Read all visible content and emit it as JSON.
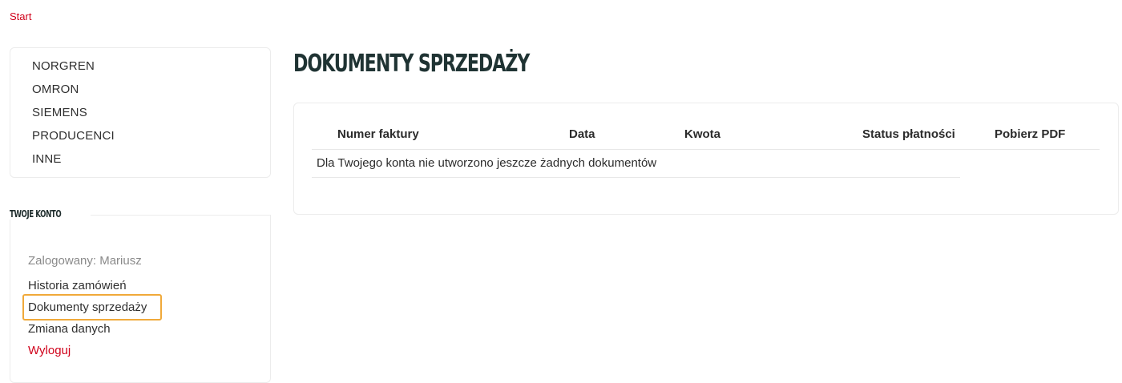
{
  "breadcrumb": {
    "start_label": "Start"
  },
  "categories": {
    "items": [
      "NORGREN",
      "OMRON",
      "SIEMENS",
      "PRODUCENCI",
      "INNE"
    ]
  },
  "account": {
    "heading": "TWOJE KONTO",
    "logged_in": "Zalogowany: Mariusz",
    "history_label": "Historia zamówień",
    "documents_label": "Dokumenty sprzedaży",
    "change_data_label": "Zmiana danych",
    "logout_label": "Wyloguj"
  },
  "main": {
    "title": "DOKUMENTY SPRZEDAŻY",
    "table": {
      "columns": [
        "Numer faktury",
        "Data",
        "Kwota",
        "Status płatności",
        "Pobierz PDF"
      ],
      "empty_message": "Dla Twojego konta nie utworzono jeszcze żadnych dokumentów"
    }
  },
  "colors": {
    "accent_red": "#d0021b",
    "highlight_orange": "#f0a93a",
    "title_dark": "#1f3333"
  }
}
